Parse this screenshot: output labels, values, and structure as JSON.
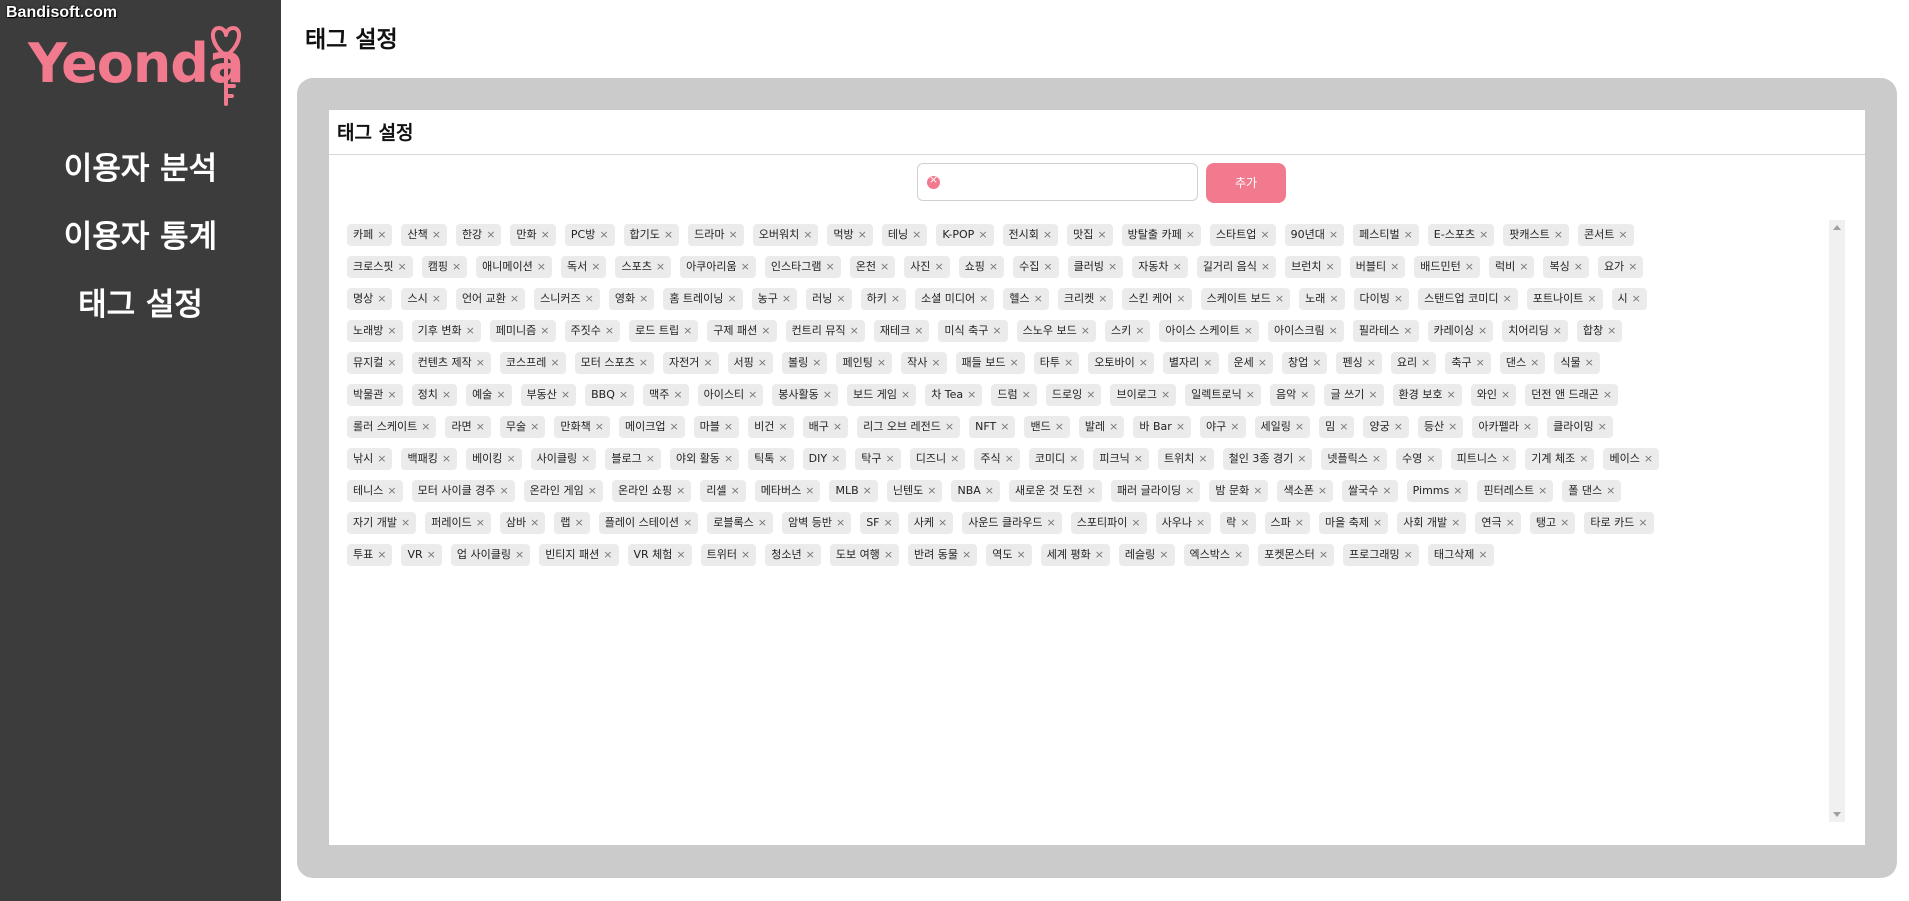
{
  "watermark": "Bandisoft.com",
  "logo": {
    "text": "Yeonda",
    "color": "#f27a8e"
  },
  "sidebar": {
    "items": [
      {
        "label": "이용자 분석"
      },
      {
        "label": "이용자 통계"
      },
      {
        "label": "태그 설정"
      }
    ]
  },
  "page": {
    "title": "태그 설정"
  },
  "card": {
    "title": "태그 설정"
  },
  "tag_input": {
    "value": "",
    "placeholder": ""
  },
  "add_button": {
    "label": "추가"
  },
  "colors": {
    "accent": "#f27a8e",
    "sidebar_bg": "#3c3c3c",
    "panel_bg": "#cbcbcb",
    "tag_bg": "#ebebeb"
  },
  "tag_rows": [
    [
      "카페",
      "산책",
      "한강",
      "만화",
      "PC방",
      "합기도",
      "드라마",
      "오버워치",
      "먹방",
      "테닝",
      "K-POP",
      "전시회",
      "맛집",
      "방탈출 카페",
      "스타트업",
      "90년대",
      "페스티벌",
      "E-스포츠",
      "팟캐스트",
      "콘서트"
    ],
    [
      "크로스핏",
      "캠핑",
      "애니메이션",
      "독서",
      "스포츠",
      "아쿠아리움",
      "인스타그램",
      "온천",
      "사진",
      "쇼핑",
      "수집",
      "클러빙",
      "자동차",
      "길거리 음식",
      "브런치",
      "버블티",
      "배드민턴",
      "럭비",
      "복싱",
      "요가"
    ],
    [
      "명상",
      "스시",
      "언어 교환",
      "스니커즈",
      "영화",
      "홈 트레이닝",
      "농구",
      "러닝",
      "하키",
      "소셜 미디어",
      "헬스",
      "크리켓",
      "스킨 케어",
      "스케이트 보드",
      "노래",
      "다이빙",
      "스탠드업 코미디",
      "포트나이트",
      "시"
    ],
    [
      "노래방",
      "기후 변화",
      "페미니즘",
      "주짓수",
      "로드 트립",
      "구제 패션",
      "컨트리 뮤직",
      "재테크",
      "미식 축구",
      "스노우 보드",
      "스키",
      "아이스 스케이트",
      "아이스크림",
      "필라테스",
      "카레이싱",
      "치어리딩",
      "합창"
    ],
    [
      "뮤지컬",
      "컨텐츠 제작",
      "코스프레",
      "모터 스포츠",
      "자전거",
      "서핑",
      "볼링",
      "페인팅",
      "작사",
      "패들 보드",
      "타투",
      "오토바이",
      "별자리",
      "운세",
      "창업",
      "펜싱",
      "요리",
      "축구",
      "댄스",
      "식물"
    ],
    [
      "박물관",
      "정치",
      "예술",
      "부동산",
      "BBQ",
      "맥주",
      "아이스티",
      "봉사활동",
      "보드 게임",
      "차 Tea",
      "드럼",
      "드로잉",
      "브이로그",
      "일렉트로닉",
      "음악",
      "글 쓰기",
      "환경 보호",
      "와인",
      "던전 앤 드래곤"
    ],
    [
      "롤러 스케이트",
      "라면",
      "무술",
      "만화책",
      "메이크업",
      "마블",
      "비건",
      "배구",
      "리그 오브 레전드",
      "NFT",
      "밴드",
      "발레",
      "바 Bar",
      "야구",
      "세일링",
      "밈",
      "양궁",
      "등산",
      "아카펠라",
      "클라이밍"
    ],
    [
      "낚시",
      "백패킹",
      "베이킹",
      "사이클링",
      "블로그",
      "야외 활동",
      "틱톡",
      "DIY",
      "탁구",
      "디즈니",
      "주식",
      "코미디",
      "피크닉",
      "트위치",
      "철인 3종 경기",
      "넷플릭스",
      "수영",
      "피트니스",
      "기계 체조",
      "베이스"
    ],
    [
      "테니스",
      "모터 사이클 경주",
      "온라인 게임",
      "온라인 쇼핑",
      "리셀",
      "메타버스",
      "MLB",
      "닌텐도",
      "NBA",
      "새로운 것 도전",
      "패러 글라이딩",
      "밤 문화",
      "색소폰",
      "쌀국수",
      "Pimms",
      "핀터레스트",
      "폴 댄스"
    ],
    [
      "자기 개발",
      "퍼레이드",
      "삼바",
      "랩",
      "플레이 스테이션",
      "로블록스",
      "암벽 등반",
      "SF",
      "사케",
      "사운드 클라우드",
      "스포티파이",
      "사우나",
      "락",
      "스파",
      "마을 축제",
      "사회 개발",
      "연극",
      "탱고",
      "타로 카드"
    ],
    [
      "투표",
      "VR",
      "업 사이클링",
      "빈티지 패션",
      "VR 체험",
      "트위터",
      "청소년",
      "도보 여행",
      "반려 동물",
      "역도",
      "세계 평화",
      "레슬링",
      "엑스박스",
      "포켓몬스터",
      "프로그래밍",
      "태그삭제"
    ]
  ]
}
